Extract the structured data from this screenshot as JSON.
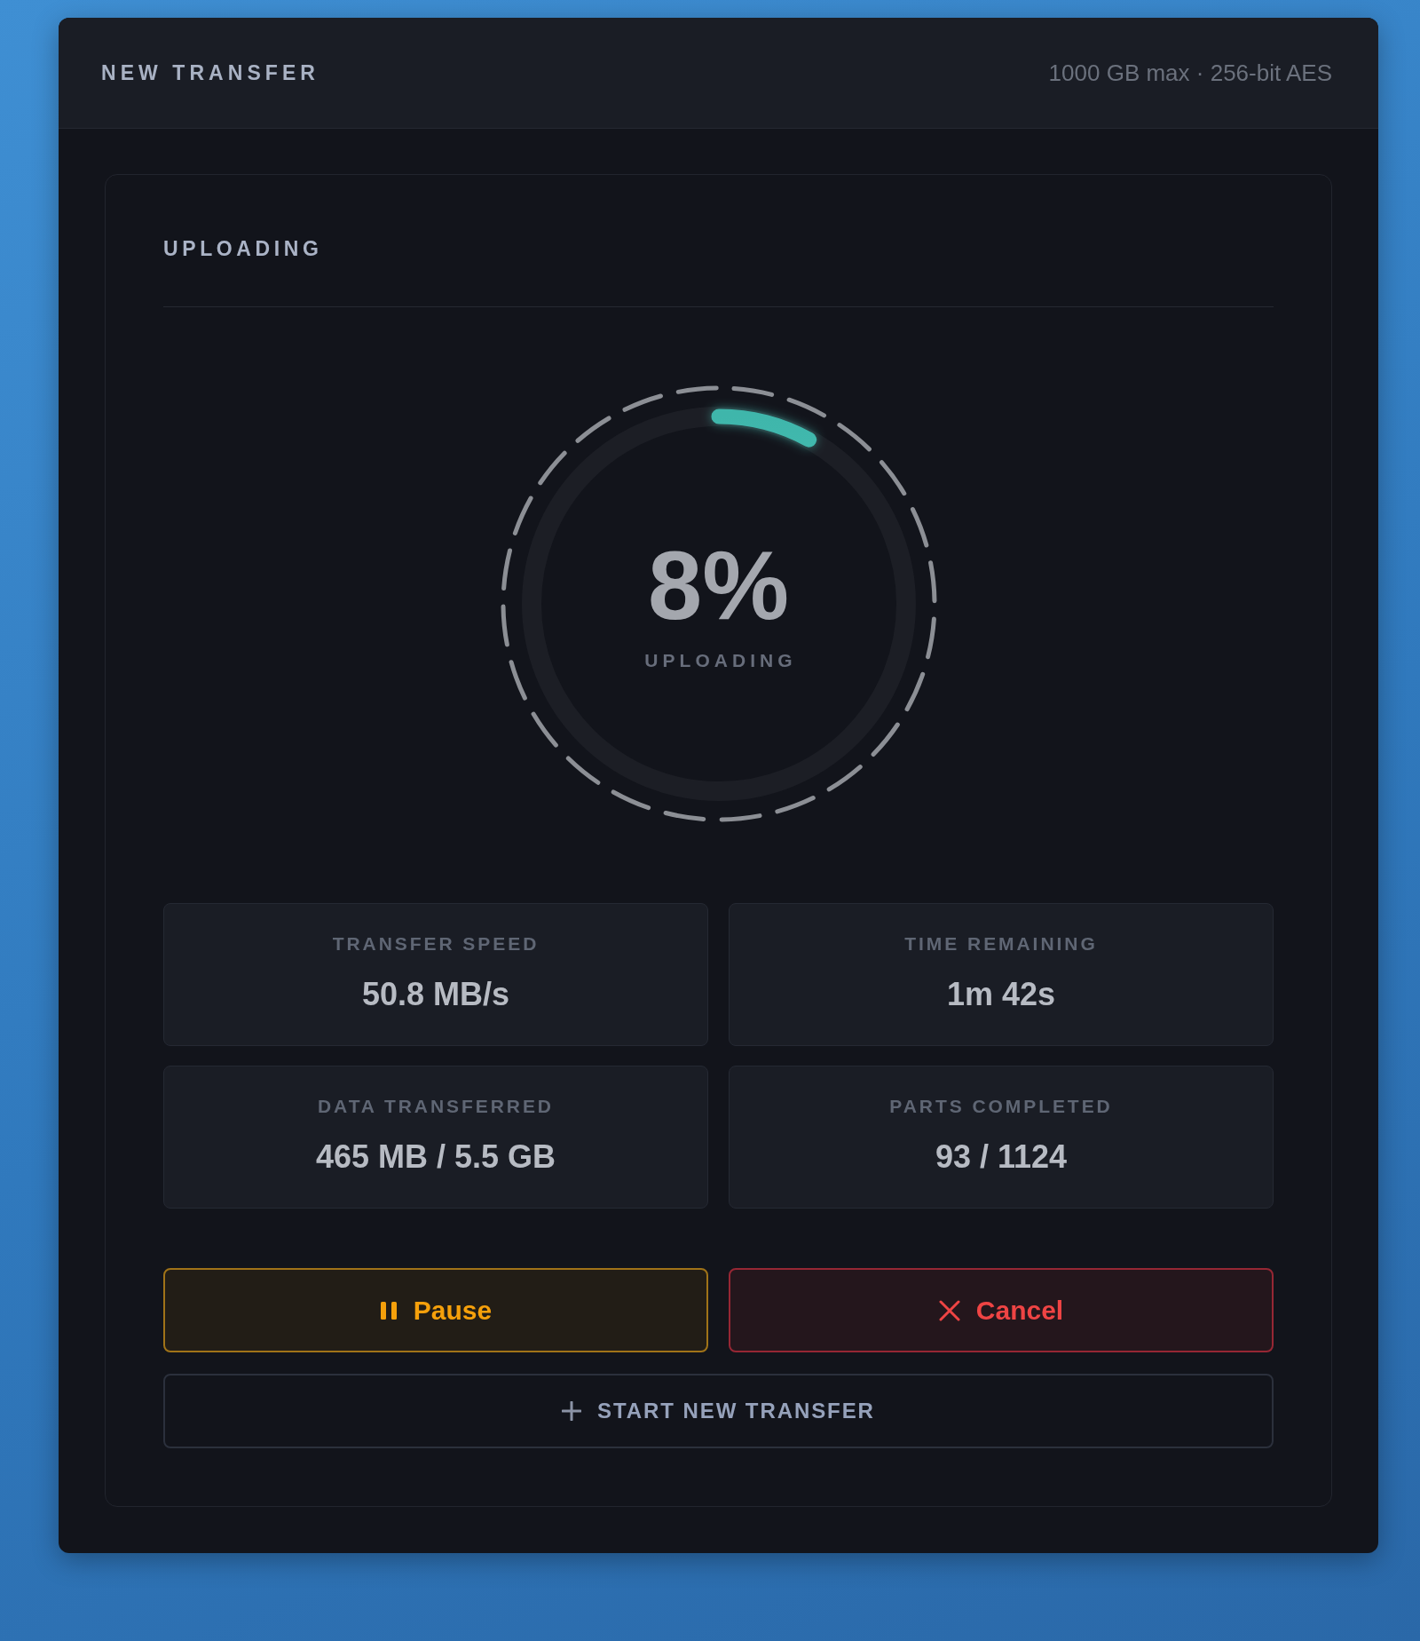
{
  "panel": {
    "title": "NEW TRANSFER",
    "meta": "1000 GB max · 256-bit AES"
  },
  "section": {
    "heading": "UPLOADING"
  },
  "progress": {
    "level": 0.08,
    "percent": "8%",
    "status": "UPLOADING"
  },
  "stats": [
    {
      "label": "TRANSFER SPEED",
      "value": "50.8 MB/s"
    },
    {
      "label": "TIME REMAINING",
      "value": "1m 42s"
    },
    {
      "label": "DATA TRANSFERRED",
      "value": "465 MB / 5.5 GB"
    },
    {
      "label": "PARTS COMPLETED",
      "value": "93 / 1124"
    }
  ],
  "actions": [
    {
      "kind": "pause",
      "label": "Pause"
    },
    {
      "kind": "cancel",
      "label": "Cancel"
    }
  ],
  "start_button": {
    "label": "START NEW TRANSFER"
  }
}
